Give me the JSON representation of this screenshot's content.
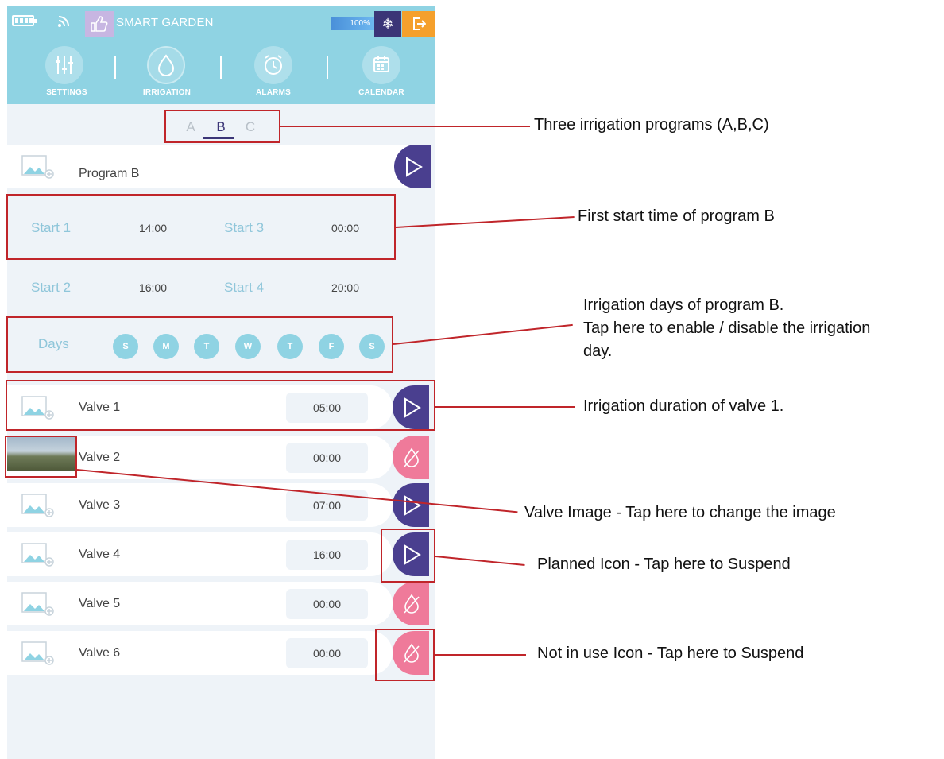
{
  "header": {
    "app_title": "SMART GARDEN",
    "battery_percent": "100%",
    "icons": [
      "battery-icon",
      "wifi-icon",
      "thumbs-up-icon",
      "snowflake-icon",
      "exit-icon"
    ]
  },
  "nav": {
    "items": [
      {
        "label": "SETTINGS",
        "icon": "sliders-icon"
      },
      {
        "label": "IRRIGATION",
        "icon": "water-drop-icon",
        "active": true
      },
      {
        "label": "ALARMS",
        "icon": "alarm-clock-icon"
      },
      {
        "label": "CALENDAR",
        "icon": "calendar-icon"
      }
    ]
  },
  "programs": {
    "tabs": [
      "A",
      "B",
      "C"
    ],
    "selected": "B"
  },
  "program": {
    "name": "Program B",
    "starts": [
      {
        "label": "Start 1",
        "time": "14:00"
      },
      {
        "label": "Start 3",
        "time": "00:00"
      },
      {
        "label": "Start 2",
        "time": "16:00"
      },
      {
        "label": "Start 4",
        "time": "20:00"
      }
    ],
    "days_label": "Days",
    "days": [
      "S",
      "M",
      "T",
      "W",
      "T",
      "F",
      "S"
    ]
  },
  "valves": [
    {
      "name": "Valve 1",
      "duration": "05:00",
      "state": "planned"
    },
    {
      "name": "Valve 2",
      "duration": "00:00",
      "state": "not-in-use"
    },
    {
      "name": "Valve 3",
      "duration": "07:00",
      "state": "planned"
    },
    {
      "name": "Valve 4",
      "duration": "16:00",
      "state": "planned"
    },
    {
      "name": "Valve 5",
      "duration": "00:00",
      "state": "not-in-use"
    },
    {
      "name": "Valve 6",
      "duration": "00:00",
      "state": "not-in-use"
    }
  ],
  "annotations": {
    "programs": "Three irrigation programs (A,B,C)",
    "first_start": "First start time of program B",
    "days_line1": "Irrigation days of program B.",
    "days_line2": "Tap here to enable / disable the irrigation",
    "days_line3": "day.",
    "duration": "Irrigation duration of valve 1.",
    "image": "Valve Image - Tap here to change the image",
    "planned": "Planned Icon - Tap here to Suspend",
    "not_in_use": "Not in use Icon - Tap here to Suspend"
  },
  "colors": {
    "header": "#8fd3e3",
    "planned": "#4a3f8f",
    "not_in_use": "#ef7a9a",
    "callout": "#c0252a"
  }
}
